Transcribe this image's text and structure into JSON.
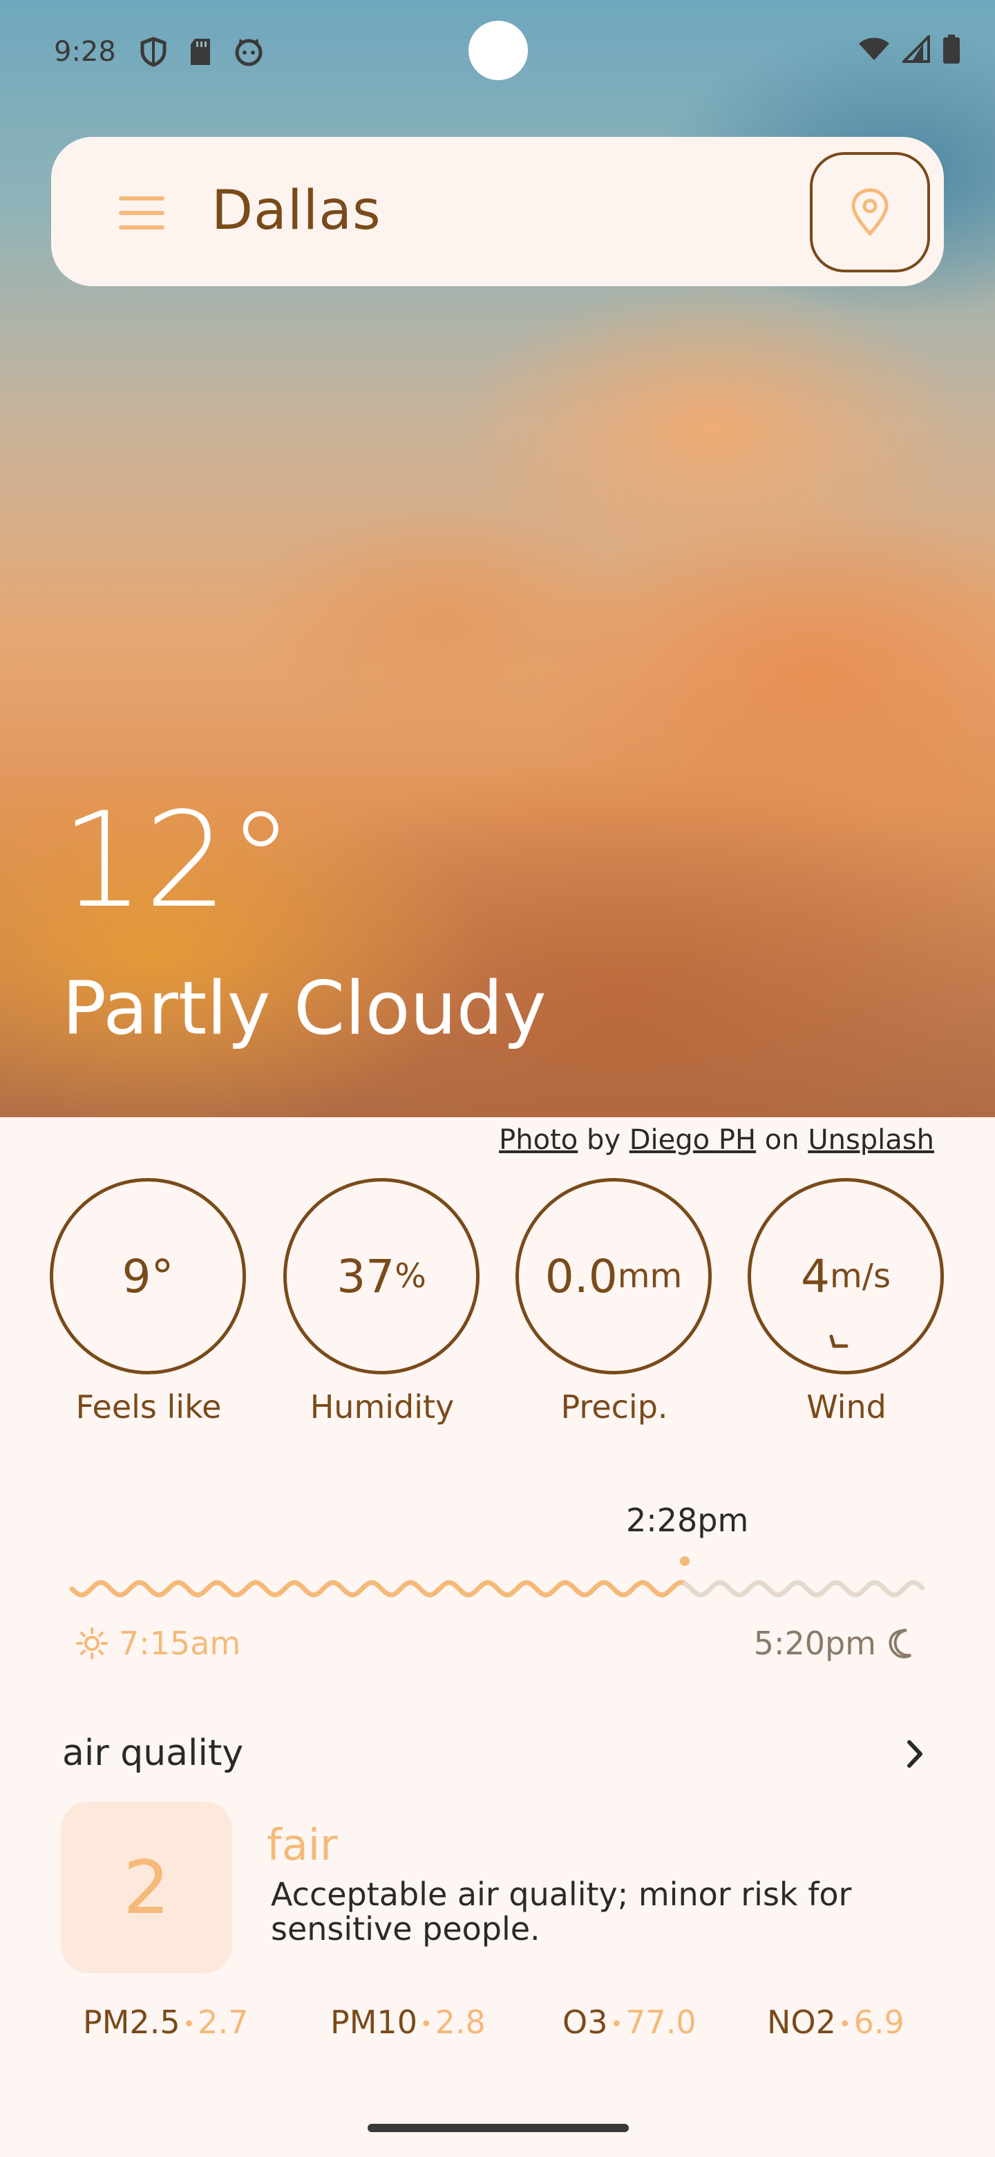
{
  "status_bar": {
    "time": "9:28",
    "left_icons": [
      "shield-icon",
      "sd-card-icon",
      "cat-face-icon"
    ],
    "right_icons": [
      "wifi-icon",
      "signal-icon",
      "battery-icon"
    ]
  },
  "search": {
    "city": "Dallas",
    "menu_icon": "hamburger-menu-icon",
    "location_icon": "location-pin-icon"
  },
  "current": {
    "temperature": "12°",
    "condition": "Partly Cloudy"
  },
  "credit": {
    "photo": "Photo",
    "by": "by",
    "author": "Diego PH",
    "on": "on",
    "site": "Unsplash"
  },
  "stats": [
    {
      "value": "9°",
      "unit": "",
      "label": "Feels like"
    },
    {
      "value": "37",
      "unit": "%",
      "label": "Humidity"
    },
    {
      "value": "0.0",
      "unit": "mm",
      "label": "Precip."
    },
    {
      "value": "4",
      "unit": "m/s",
      "label": "Wind"
    }
  ],
  "sun": {
    "now": "2:28pm",
    "sunrise": "7:15am",
    "sunset": "5:20pm",
    "day_progress": 0.72
  },
  "air_quality": {
    "title": "air quality",
    "index": "2",
    "label": "fair",
    "description": "Acceptable air quality; minor risk for sensitive people.",
    "pollutants": [
      {
        "name": "PM2.5",
        "value": "2.7"
      },
      {
        "name": "PM10",
        "value": "2.8"
      },
      {
        "name": "O3",
        "value": "77.0"
      },
      {
        "name": "NO2",
        "value": "6.9"
      }
    ]
  },
  "colors": {
    "accent_brown": "#7A4A1A",
    "accent_orange": "#F5B979",
    "background": "#FDF6F3"
  }
}
